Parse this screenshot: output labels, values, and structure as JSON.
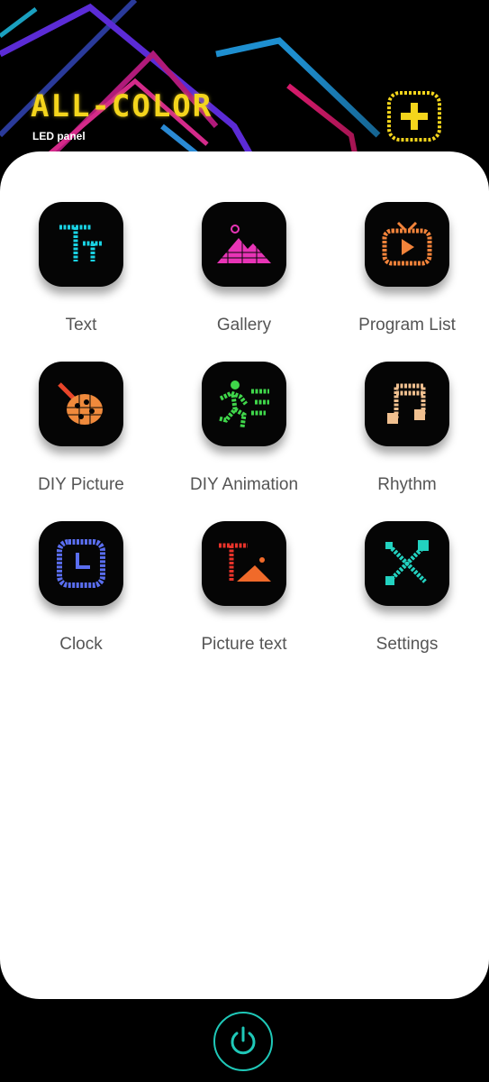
{
  "header": {
    "logo_text": "ALL-COLOR",
    "logo_subtitle": "LED panel",
    "add_icon": "add-program-icon"
  },
  "menu": [
    {
      "label": "Text",
      "icon": "text-icon",
      "color": "#19d2e3"
    },
    {
      "label": "Gallery",
      "icon": "gallery-icon",
      "color": "#e834b6"
    },
    {
      "label": "Program List",
      "icon": "tv-icon",
      "color": "#f2833a"
    },
    {
      "label": "DIY Picture",
      "icon": "palette-icon",
      "color": "#f08a3c"
    },
    {
      "label": "DIY Animation",
      "icon": "running-man-icon",
      "color": "#3fd64a"
    },
    {
      "label": "Rhythm",
      "icon": "music-note-icon",
      "color": "#f0c090"
    },
    {
      "label": "Clock",
      "icon": "clock-icon",
      "color": "#5a6ef0"
    },
    {
      "label": "Picture text",
      "icon": "picture-text-icon",
      "color": "#f04a2a"
    },
    {
      "label": "Settings",
      "icon": "tools-icon",
      "color": "#22d2c0"
    }
  ],
  "bottom": {
    "power_icon": "power-icon",
    "power_color": "#1fc8b8"
  }
}
